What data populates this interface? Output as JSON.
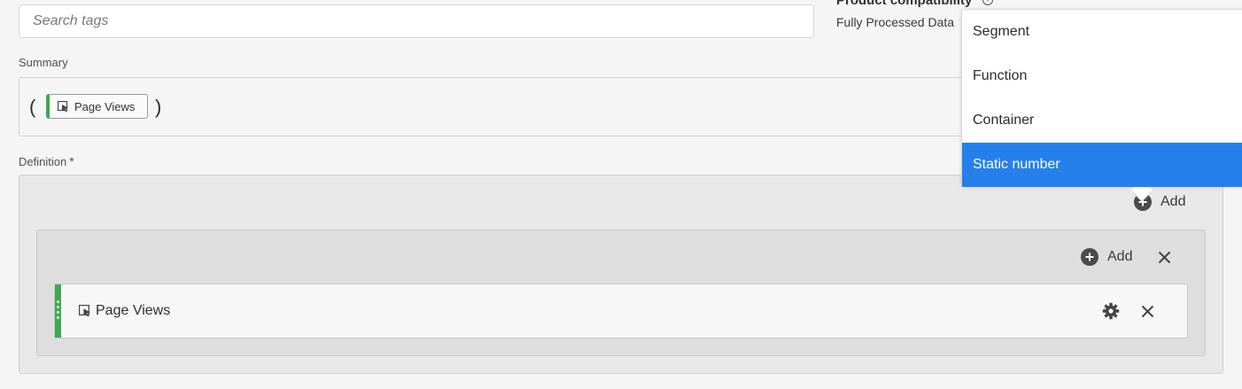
{
  "search": {
    "placeholder": "Search tags",
    "value": ""
  },
  "product_compatibility": {
    "title": "Product compatibility",
    "value": "Fully Processed Data"
  },
  "summary": {
    "label": "Summary",
    "open_paren": "(",
    "close_paren": ")",
    "chip": {
      "label": "Page Views",
      "icon": "metric-icon",
      "accent": "#3daa4f"
    }
  },
  "definition": {
    "label": "Definition",
    "required_mark": "*",
    "add_label": "Add",
    "container": {
      "add_label": "Add",
      "metric": {
        "label": "Page Views",
        "icon": "metric-icon",
        "accent": "#3daa4f"
      }
    }
  },
  "add_menu": {
    "items": [
      {
        "label": "Segment",
        "selected": false
      },
      {
        "label": "Function",
        "selected": false
      },
      {
        "label": "Container",
        "selected": false
      },
      {
        "label": "Static number",
        "selected": true
      }
    ],
    "highlight_color": "#2680eb"
  }
}
